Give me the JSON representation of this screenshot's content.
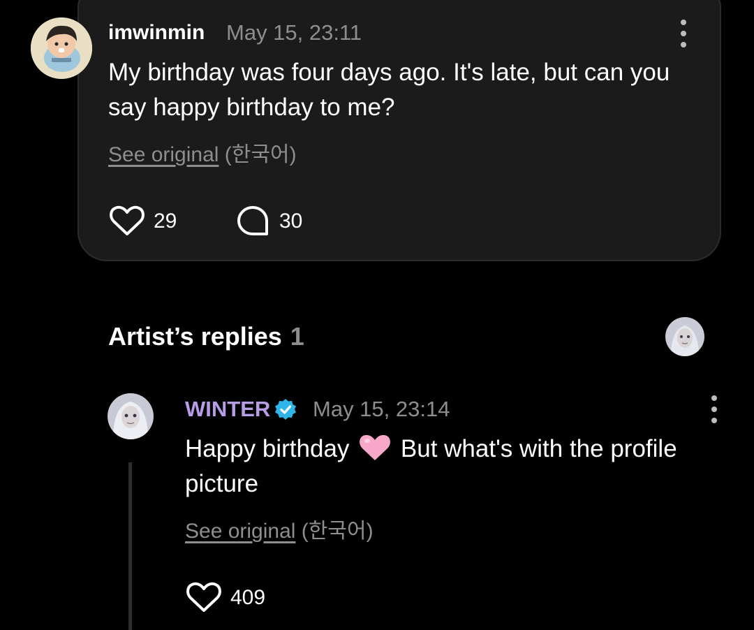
{
  "comment": {
    "username": "imwinmin",
    "timestamp": "May 15, 23:11",
    "text": "My birthday was four days ago. It's late, but can you say happy birthday to me?",
    "see_original_label": "See original",
    "language": "(한국어)",
    "like_count": "29",
    "reply_count": "30",
    "avatar_icon": "baby-avatar",
    "more_icon": "more-vertical-icon"
  },
  "artist_replies": {
    "title": "Artist’s replies",
    "count": "1",
    "avatar_icon": "artist-avatar"
  },
  "reply": {
    "username": "WINTER",
    "verified_icon": "verified-badge-icon",
    "timestamp": "May 15, 23:14",
    "text_before_emoji": "Happy birthday",
    "emoji": "pink-heart-emoji",
    "text_after_emoji": "But what's with the profile picture",
    "see_original_label": "See original",
    "language": "(한국어)",
    "like_count": "409",
    "more_icon": "more-vertical-icon"
  },
  "colors": {
    "background": "#000000",
    "card": "#1b1b1b",
    "artist_name": "#b79ce6",
    "verified_badge": "#2fb6e8",
    "muted_text": "#8e8e8e",
    "heart_emoji": "#f7a8c8"
  }
}
